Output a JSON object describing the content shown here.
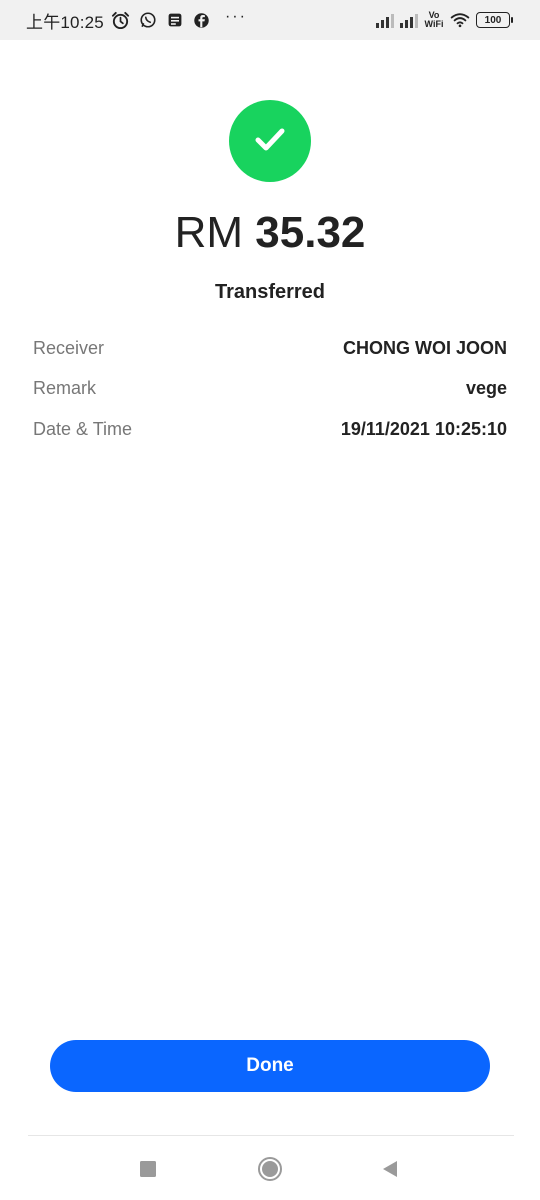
{
  "status_bar": {
    "time": "上午10:25",
    "more": "···",
    "vowifi_top": "Vo",
    "vowifi_bottom": "WiFi",
    "battery": "100"
  },
  "result": {
    "currency": "RM",
    "amount": "35.32",
    "status": "Transferred",
    "accent_color": "#18d35e"
  },
  "details": [
    {
      "label": "Receiver",
      "value": "CHONG WOI JOON"
    },
    {
      "label": "Remark",
      "value": "vege"
    },
    {
      "label": "Date & Time",
      "value": "19/11/2021 10:25:10"
    }
  ],
  "actions": {
    "done_label": "Done",
    "button_color": "#0a66ff"
  },
  "icons": [
    "alarm-icon",
    "whatsapp-icon",
    "message-icon",
    "facebook-icon",
    "signal-icon",
    "wifi-icon",
    "battery-icon",
    "checkmark-icon",
    "recents-icon",
    "home-icon",
    "back-icon"
  ]
}
